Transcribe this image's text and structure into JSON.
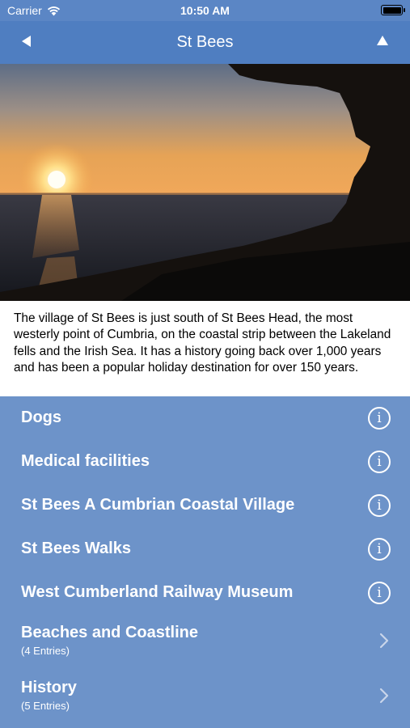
{
  "status": {
    "carrier": "Carrier",
    "time": "10:50 AM"
  },
  "nav": {
    "title": "St Bees",
    "back_icon": "back-triangle-icon",
    "up_icon": "up-triangle-icon"
  },
  "intro": "The village of St Bees is just south of St Bees Head, the most westerly point of Cumbria, on the coastal strip between the Lakeland fells and the Irish Sea. It has a history going back over 1,000 years and has been a popular holiday destination for over 150 years.",
  "items": [
    {
      "label": "Dogs",
      "accessory": "info-icon"
    },
    {
      "label": "Medical facilities",
      "accessory": "info-icon"
    },
    {
      "label": "St Bees A Cumbrian Coastal Village",
      "accessory": "info-icon"
    },
    {
      "label": "St Bees Walks",
      "accessory": "info-icon"
    },
    {
      "label": "West Cumberland Railway Museum",
      "accessory": "info-icon"
    }
  ],
  "groups": [
    {
      "label": "Beaches and Coastline",
      "sub": "(4 Entries)",
      "accessory": "chevron-right-icon"
    },
    {
      "label": "History",
      "sub": "(5 Entries)",
      "accessory": "chevron-right-icon"
    }
  ],
  "colors": {
    "nav": "#4f7ec1",
    "list": "#6d93c9"
  }
}
